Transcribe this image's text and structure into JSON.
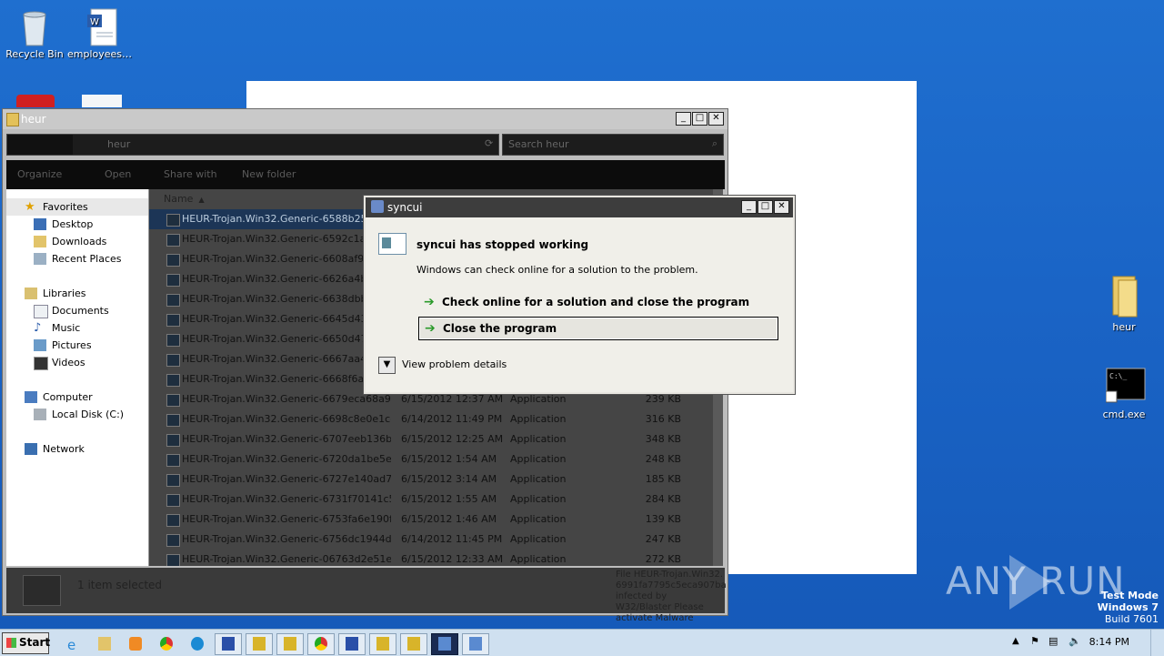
{
  "desktop": {
    "icons": [
      {
        "label": "Recycle Bin"
      },
      {
        "label": "employeesc..."
      },
      {
        "label": "heur"
      },
      {
        "label": "cmd.exe"
      }
    ]
  },
  "explorer": {
    "title": "heur",
    "address": "heur",
    "search_placeholder": "Search heur",
    "toolbar": {
      "organize": "Organize",
      "open": "Open",
      "share_with": "Share with",
      "new_folder": "New folder"
    },
    "nav": [
      {
        "label": "Favorites",
        "icon": "star-icon"
      },
      {
        "label": "Desktop",
        "icon": "desktop-icon"
      },
      {
        "label": "Downloads",
        "icon": "downloads-icon"
      },
      {
        "label": "Recent Places",
        "icon": "recent-places-icon"
      },
      {
        "label": "Libraries",
        "icon": "libraries-icon"
      },
      {
        "label": "Documents",
        "icon": "documents-icon"
      },
      {
        "label": "Music",
        "icon": "music-icon"
      },
      {
        "label": "Pictures",
        "icon": "pictures-icon"
      },
      {
        "label": "Videos",
        "icon": "videos-icon"
      },
      {
        "label": "Computer",
        "icon": "computer-icon"
      },
      {
        "label": "Local Disk (C:)",
        "icon": "disk-icon"
      },
      {
        "label": "Network",
        "icon": "network-icon"
      }
    ],
    "columns": {
      "name": "Name"
    },
    "files": [
      {
        "name": "HEUR-Trojan.Win32.Generic-6588b252cb",
        "date": "",
        "type": "",
        "size": ""
      },
      {
        "name": "HEUR-Trojan.Win32.Generic-6592c1a5ae",
        "date": "",
        "type": "",
        "size": ""
      },
      {
        "name": "HEUR-Trojan.Win32.Generic-6608af9471",
        "date": "",
        "type": "",
        "size": ""
      },
      {
        "name": "HEUR-Trojan.Win32.Generic-6626a4b69c",
        "date": "",
        "type": "",
        "size": ""
      },
      {
        "name": "HEUR-Trojan.Win32.Generic-6638dbbf07",
        "date": "",
        "type": "",
        "size": ""
      },
      {
        "name": "HEUR-Trojan.Win32.Generic-6645d43651",
        "date": "",
        "type": "",
        "size": ""
      },
      {
        "name": "HEUR-Trojan.Win32.Generic-6650d473e4",
        "date": "",
        "type": "",
        "size": ""
      },
      {
        "name": "HEUR-Trojan.Win32.Generic-6667aa4f8c",
        "date": "",
        "type": "",
        "size": ""
      },
      {
        "name": "HEUR-Trojan.Win32.Generic-6668f6ab6a",
        "date": "",
        "type": "",
        "size": ""
      },
      {
        "name": "HEUR-Trojan.Win32.Generic-6679eca68a95c...",
        "date": "6/15/2012 12:37 AM",
        "type": "Application",
        "size": "239 KB"
      },
      {
        "name": "HEUR-Trojan.Win32.Generic-6698c8e0e1cea...",
        "date": "6/14/2012 11:49 PM",
        "type": "Application",
        "size": "316 KB"
      },
      {
        "name": "HEUR-Trojan.Win32.Generic-6707eeb136b3...",
        "date": "6/15/2012 12:25 AM",
        "type": "Application",
        "size": "348 KB"
      },
      {
        "name": "HEUR-Trojan.Win32.Generic-6720da1be5ea...",
        "date": "6/15/2012 1:54 AM",
        "type": "Application",
        "size": "248 KB"
      },
      {
        "name": "HEUR-Trojan.Win32.Generic-6727e140ad75f...",
        "date": "6/15/2012 3:14 AM",
        "type": "Application",
        "size": "185 KB"
      },
      {
        "name": "HEUR-Trojan.Win32.Generic-6731f70141c58...",
        "date": "6/15/2012 1:55 AM",
        "type": "Application",
        "size": "284 KB"
      },
      {
        "name": "HEUR-Trojan.Win32.Generic-6753fa6e190fa...",
        "date": "6/15/2012 1:46 AM",
        "type": "Application",
        "size": "139 KB"
      },
      {
        "name": "HEUR-Trojan.Win32.Generic-6756dc1944dd...",
        "date": "6/14/2012 11:45 PM",
        "type": "Application",
        "size": "247 KB"
      },
      {
        "name": "HEUR-Trojan.Win32.Generic-06763d2e51e1...",
        "date": "6/15/2012 12:33 AM",
        "type": "Application",
        "size": "272 KB"
      }
    ],
    "details": {
      "selected": "1 item selected",
      "info": "File HEUR-Trojan.Win32. 6991fa7795c5eca907ba infected by W32/Blaster Please activate Malware"
    }
  },
  "dialog": {
    "title": "syncui",
    "heading": "syncui has stopped working",
    "subtext": "Windows can check online for a solution to the problem.",
    "option1": "Check online for a solution and close the program",
    "option2": "Close the program",
    "details_label": "View problem details"
  },
  "taskbar": {
    "start": "Start",
    "clock": "8:14 PM"
  },
  "watermark": {
    "text": "ANY RUN"
  },
  "os_info": {
    "line1": "Test Mode",
    "line2": "Windows 7",
    "line3": "Build 7601"
  }
}
